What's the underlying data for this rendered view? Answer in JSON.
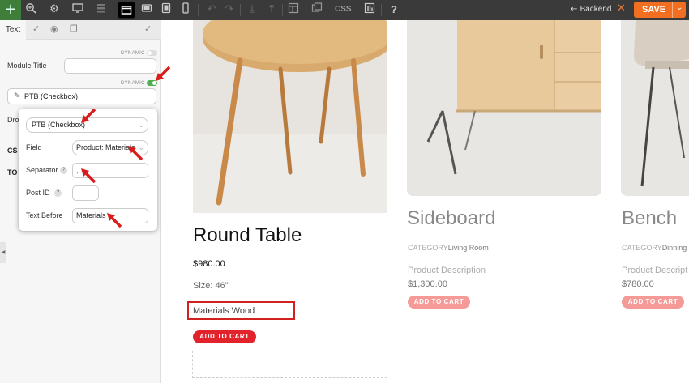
{
  "toolbar": {
    "css_label": "CSS",
    "backend_label": "Backend",
    "save_label": "SAVE",
    "help_label": "?"
  },
  "panel": {
    "tab_text": "Text",
    "module_title_label": "Module Title",
    "dynamic_label": "DYNAMIC",
    "source_value": "PTB (Checkbox)",
    "dro_label": "Dro",
    "cs_label": "CS",
    "to_label": "TO"
  },
  "popup": {
    "source_select": "PTB (Checkbox)",
    "field_label": "Field",
    "field_value": "Product: Materials",
    "separator_label": "Separator",
    "separator_value": ",",
    "post_id_label": "Post ID",
    "post_id_value": "",
    "text_before_label": "Text Before",
    "text_before_value": "Materials"
  },
  "products": [
    {
      "title": "Round Table",
      "price": "$980.00",
      "size": "Size: 46\"",
      "materials": "Materials Wood",
      "cart_label": "ADD TO CART"
    },
    {
      "title": "Sideboard",
      "category_label": "CATEGORY",
      "category_value": "Living Room",
      "description": "Product Description",
      "price": "$1,300.00",
      "cart_label": "ADD TO CART"
    },
    {
      "title": "Bench",
      "category_label": "CATEGORY",
      "category_value": "Dinning",
      "description": "Product Descript",
      "price": "$780.00",
      "cart_label": "ADD TO CART"
    }
  ],
  "colors": {
    "accent_red": "#e3232b",
    "save_orange": "#f26f21",
    "toggle_green": "#4caf50",
    "highlight_border": "#d32020"
  }
}
